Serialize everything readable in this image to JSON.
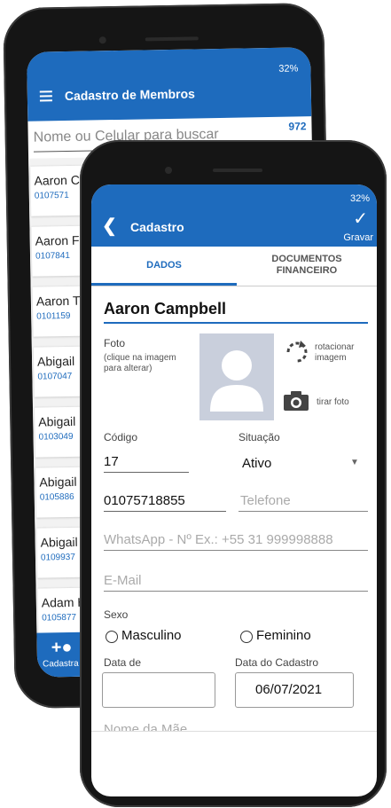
{
  "back_app": {
    "status": "32%",
    "title": "Cadastro de Membros",
    "search_placeholder": "Nome ou Celular para buscar",
    "count": "972",
    "rows": [
      {
        "name": "Aaron C",
        "phone": "0107571"
      },
      {
        "name": "Aaron F",
        "phone": "0107841"
      },
      {
        "name": "Aaron T",
        "phone": "0101159"
      },
      {
        "name": "Abigail",
        "phone": "0107047"
      },
      {
        "name": "Abigail",
        "phone": "0103049"
      },
      {
        "name": "Abigail",
        "phone": "0105886"
      },
      {
        "name": "Abigail",
        "phone": "0109937"
      },
      {
        "name": "Adam H",
        "phone": "0105877"
      }
    ],
    "bottom_nav_label": "Cadastra"
  },
  "front_app": {
    "status": "32%",
    "title": "Cadastro",
    "save_label": "Gravar",
    "tabs": {
      "dados": "DADOS",
      "documentos_line1": "DOCUMENTOS",
      "documentos_line2": "FINANCEIRO"
    },
    "member_name": "Aaron Campbell",
    "photo": {
      "label": "Foto",
      "hint_line1": "(clique na imagem",
      "hint_line2": "para alterar)",
      "rotate_line1": "rotacionar",
      "rotate_line2": "imagem",
      "take_photo": "tirar foto"
    },
    "fields": {
      "codigo_label": "Código",
      "codigo_value": "17",
      "situacao_label": "Situação",
      "situacao_value": "Ativo",
      "celular_value": "01075718855",
      "telefone_placeholder": "Telefone",
      "whatsapp_placeholder": "WhatsApp - Nº Ex.: +55 31 999998888",
      "email_placeholder": "E-Mail",
      "sexo_label": "Sexo",
      "masculino": "Masculino",
      "feminino": "Feminino",
      "data_label": "Data de",
      "data_cadastro_label": "Data do Cadastro",
      "data_cadastro_value": "06/07/2021",
      "nome_mae_placeholder": "Nome da Mãe"
    }
  },
  "colors": {
    "primary": "#1e6bbd",
    "photo_bg": "#c9cfdc"
  }
}
